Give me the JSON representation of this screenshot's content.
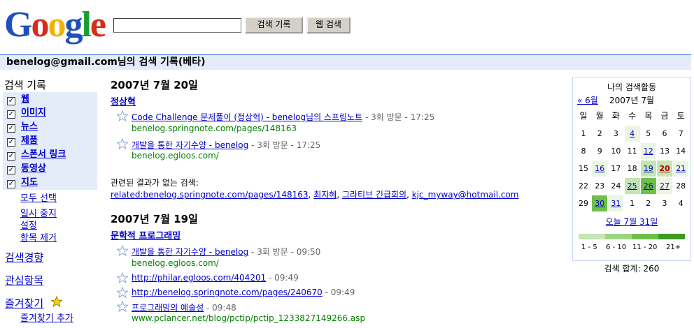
{
  "header": {
    "logo_letters": [
      "G",
      "o",
      "o",
      "g",
      "l",
      "e"
    ],
    "logo_colors": [
      "#1f4fbd",
      "#d62c1a",
      "#f0b400",
      "#1f4fbd",
      "#1a9c32",
      "#d62c1a"
    ],
    "search_value": "",
    "btn_history": "검색 기록",
    "btn_web": "웹 검색",
    "title": "benelog@gmail.com님의 검색 기록(베타)"
  },
  "sidebar": {
    "heading": "검색 기록",
    "filters": [
      {
        "label": "웹",
        "checked": "✓"
      },
      {
        "label": "이미지",
        "checked": "✓"
      },
      {
        "label": "뉴스",
        "checked": "✓"
      },
      {
        "label": "제품",
        "checked": "✓"
      },
      {
        "label": "스폰서 링크",
        "checked": "✓"
      },
      {
        "label": "동영상",
        "checked": "✓"
      },
      {
        "label": "지도",
        "checked": "✓"
      }
    ],
    "actions": [
      "모두 선택",
      "일시 중지",
      "설정",
      "항목 제거"
    ],
    "trends": "검색경향",
    "interests": "관심항목",
    "bookmarks": "즐겨찾기",
    "bookmark_add": "즐겨찾기 추가"
  },
  "days": [
    {
      "date": "2007년 7월 20일",
      "groups": [
        {
          "query": "정상혁",
          "results": [
            {
              "title": "Code Challenge 문제풀이 (정상혁) - benelog님의 스프링노트",
              "meta": " - 3회 방문 - 17:25",
              "url": "benelog.springnote.com/pages/148163"
            },
            {
              "title": "개발을 통한 자기수양 - benelog",
              "meta": " - 3회 방문 - 17:25",
              "url": "benelog.egloos.com/"
            }
          ]
        }
      ],
      "related_label": "관련된 결과가 없는 검색:",
      "related": [
        "related:benelog.springnote.com/pages/148163",
        "최지혜",
        "그라티브 긴급회의",
        "kjc_myway@hotmail.com"
      ]
    },
    {
      "date": "2007년 7월 19일",
      "groups": [
        {
          "query": "문학적 프로그래밍",
          "results": [
            {
              "title": "개발을 통한 자기수양 - benelog",
              "meta": " - 3회 방문 - 09:50",
              "url": "benelog.egloos.com/"
            },
            {
              "title": "http://philar.egloos.com/404201",
              "meta": " - 09:49",
              "url": ""
            },
            {
              "title": "http://benelog.springnote.com/pages/240670",
              "meta": " - 09:49",
              "url": ""
            },
            {
              "title": "프로그래밍의 예술성",
              "meta": " - 09:48",
              "url": "www.pclancer.net/blog/pctip/pctip_1233827149266.asp"
            }
          ]
        }
      ]
    }
  ],
  "calendar": {
    "title": "나의 검색활동",
    "prev": "« 6월",
    "month": "2007년 7월",
    "weekdays": [
      "일",
      "월",
      "화",
      "수",
      "목",
      "금",
      "토"
    ],
    "weeks": [
      [
        "1",
        "2",
        "3",
        "4",
        "5",
        "6",
        "7"
      ],
      [
        "8",
        "9",
        "10",
        "11",
        "12",
        "13",
        "14"
      ],
      [
        "15",
        "16",
        "17",
        "18",
        "19",
        "20",
        "21"
      ],
      [
        "22",
        "23",
        "24",
        "25",
        "26",
        "27",
        "28"
      ],
      [
        "29",
        "30",
        "31",
        "1",
        "2",
        "3",
        "4"
      ]
    ],
    "today_link": "오늘 7월 31일",
    "legend": [
      "1 - 5",
      "6 - 10",
      "11 - 20",
      "21+"
    ],
    "legend_colors": [
      "#c3e6b3",
      "#9cd582",
      "#6fbf4a",
      "#3d9a25"
    ],
    "total": "검색 합계: 260"
  }
}
